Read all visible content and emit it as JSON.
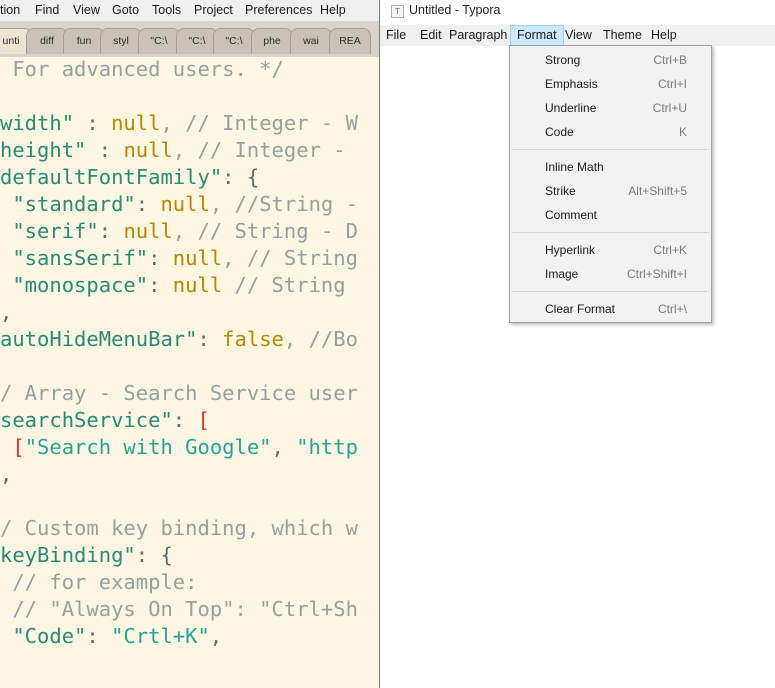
{
  "editor": {
    "menubar": [
      "tion",
      "Find",
      "View",
      "Goto",
      "Tools",
      "Project",
      "Preferences",
      "Help"
    ],
    "tabs": [
      "unti",
      "diff",
      "fun",
      "styl",
      "\"C:\\",
      "\"C:\\",
      "\"C:\\",
      "phe",
      "wai",
      "REA"
    ],
    "code_lines": [
      [
        {
          "t": " For advanced users. */",
          "c": "c"
        }
      ],
      [],
      [
        {
          "t": "width\"",
          "c": "key"
        },
        {
          "t": " : ",
          "c": "p"
        },
        {
          "t": "null",
          "c": "n"
        },
        {
          "t": ", // Integer - W",
          "c": "c"
        }
      ],
      [
        {
          "t": "height\"",
          "c": "key"
        },
        {
          "t": " : ",
          "c": "p"
        },
        {
          "t": "null",
          "c": "n"
        },
        {
          "t": ", // Integer - ",
          "c": "c"
        }
      ],
      [
        {
          "t": "defaultFontFamily\"",
          "c": "key"
        },
        {
          "t": ": {",
          "c": "p"
        }
      ],
      [
        {
          "t": " \"standard\"",
          "c": "key"
        },
        {
          "t": ": ",
          "c": "p"
        },
        {
          "t": "null",
          "c": "n"
        },
        {
          "t": ", //String - ",
          "c": "c"
        }
      ],
      [
        {
          "t": " \"serif\"",
          "c": "key"
        },
        {
          "t": ": ",
          "c": "p"
        },
        {
          "t": "null",
          "c": "n"
        },
        {
          "t": ", // String - D",
          "c": "c"
        }
      ],
      [
        {
          "t": " \"sansSerif\"",
          "c": "key"
        },
        {
          "t": ": ",
          "c": "p"
        },
        {
          "t": "null",
          "c": "n"
        },
        {
          "t": ", // String",
          "c": "c"
        }
      ],
      [
        {
          "t": " \"monospace\"",
          "c": "key"
        },
        {
          "t": ": ",
          "c": "p"
        },
        {
          "t": "null",
          "c": "n"
        },
        {
          "t": " // String ",
          "c": "c"
        }
      ],
      [
        {
          "t": ",",
          "c": "p"
        }
      ],
      [
        {
          "t": "autoHideMenuBar\"",
          "c": "key"
        },
        {
          "t": ": ",
          "c": "p"
        },
        {
          "t": "false",
          "c": "n"
        },
        {
          "t": ", //Bo",
          "c": "c"
        }
      ],
      [],
      [
        {
          "t": "/ Array - Search Service user",
          "c": "c"
        }
      ],
      [
        {
          "t": "searchService\"",
          "c": "key"
        },
        {
          "t": ": ",
          "c": "p"
        },
        {
          "t": "[",
          "c": "r"
        }
      ],
      [
        {
          "t": " ",
          "c": "p"
        },
        {
          "t": "[",
          "c": "r"
        },
        {
          "t": "\"Search with Google\"",
          "c": "s"
        },
        {
          "t": ", ",
          "c": "p"
        },
        {
          "t": "\"http",
          "c": "s"
        }
      ],
      [
        {
          "t": ",",
          "c": "p"
        }
      ],
      [],
      [
        {
          "t": "/ Custom key binding, which w",
          "c": "c"
        }
      ],
      [
        {
          "t": "keyBinding\"",
          "c": "key"
        },
        {
          "t": ": {",
          "c": "p"
        }
      ],
      [
        {
          "t": " // for example:",
          "c": "c"
        }
      ],
      [
        {
          "t": " // \"Always On Top\": \"Ctrl+Sh",
          "c": "c"
        }
      ],
      [
        {
          "t": " \"Code\"",
          "c": "key"
        },
        {
          "t": ": ",
          "c": "p"
        },
        {
          "t": "\"Crtl+K\"",
          "c": "s"
        },
        {
          "t": ",",
          "c": "p"
        }
      ],
      [],
      [
        {
          "t": ",",
          "c": "p"
        }
      ]
    ]
  },
  "typora": {
    "title": "Untitled - Typora",
    "icon_letter": "T",
    "menubar": [
      "File",
      "Edit",
      "Paragraph",
      "Format",
      "View",
      "Theme",
      "Help"
    ],
    "active_menu": "Format",
    "format_menu": [
      {
        "label": "Strong",
        "shortcut": "Ctrl+B"
      },
      {
        "label": "Emphasis",
        "shortcut": "Ctrl+I"
      },
      {
        "label": "Underline",
        "shortcut": "Ctrl+U"
      },
      {
        "label": "Code",
        "shortcut": "K"
      },
      {
        "separator": true
      },
      {
        "label": "Inline Math",
        "shortcut": ""
      },
      {
        "label": "Strike",
        "shortcut": "Alt+Shift+5"
      },
      {
        "label": "Comment",
        "shortcut": ""
      },
      {
        "separator": true
      },
      {
        "label": "Hyperlink",
        "shortcut": "Ctrl+K"
      },
      {
        "label": "Image",
        "shortcut": "Ctrl+Shift+I"
      },
      {
        "separator": true
      },
      {
        "label": "Clear Format",
        "shortcut": "Ctrl+\\"
      }
    ]
  }
}
